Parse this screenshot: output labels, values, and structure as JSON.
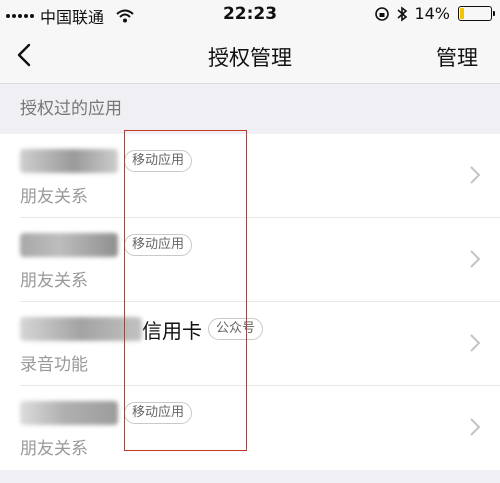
{
  "status_bar": {
    "carrier": "中国联通",
    "time": "22:23",
    "battery_text": "14%",
    "battery_level": 0.14
  },
  "nav": {
    "title": "授权管理",
    "manage_label": "管理"
  },
  "section": {
    "header": "授权过的应用"
  },
  "apps": [
    {
      "name_tail": "",
      "tag": "移动应用",
      "permission": "朋友关系"
    },
    {
      "name_tail": "",
      "tag": "移动应用",
      "permission": "朋友关系"
    },
    {
      "name_tail": "信用卡",
      "tag": "公众号",
      "permission": "录音功能"
    },
    {
      "name_tail": "",
      "tag": "移动应用",
      "permission": "朋友关系"
    }
  ],
  "colors": {
    "background": "#efeff4",
    "battery_fill": "#f5c400",
    "highlight_box": "#c0392b"
  }
}
